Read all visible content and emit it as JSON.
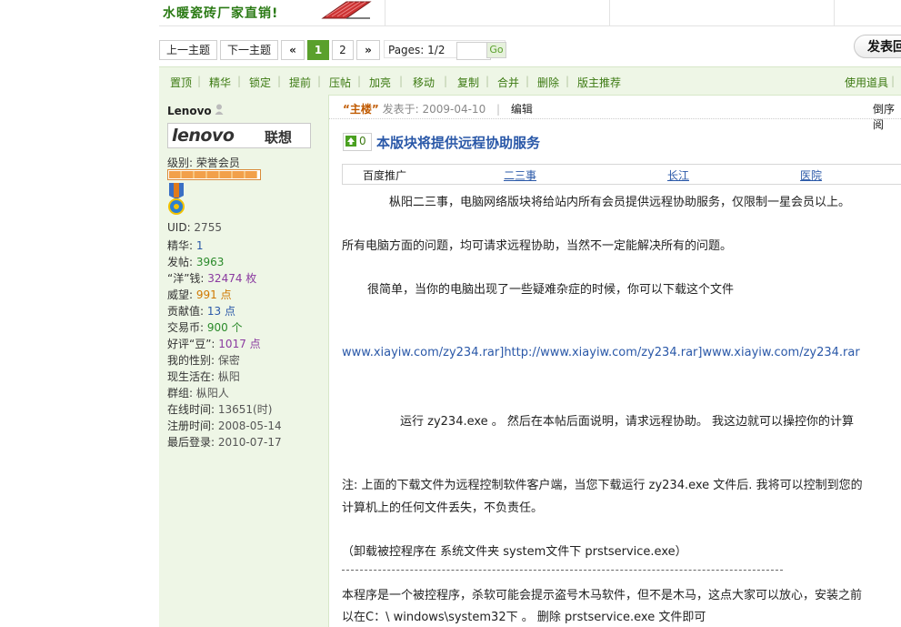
{
  "ad": {
    "text": "水暖瓷砖厂家直销!"
  },
  "pager": {
    "prev_topic": "上一主题",
    "next_topic": "下一主题",
    "first": "«",
    "page1": "1",
    "page2": "2",
    "next": "»",
    "pages_text": "Pages: 1/2",
    "go": "Go",
    "input_value": ""
  },
  "new_topic_button": "发表回",
  "toolbar": {
    "items": [
      "置顶",
      "精华",
      "锁定",
      "提前",
      "压帖",
      "加亮",
      "移动",
      "复制",
      "合并",
      "删除",
      "版主推荐"
    ],
    "right": "使用道具"
  },
  "user": {
    "name": "Lenovo",
    "logo_latin": "lenovo",
    "logo_cn": "联想",
    "level": "级别: 荣誉会员",
    "level_progress": 0.98,
    "fields": [
      {
        "label": "UID: ",
        "value": "2755",
        "cls": "val-gray"
      },
      {
        "label": "精华: ",
        "value": "1",
        "cls": "val-blue"
      },
      {
        "label": "发帖: ",
        "value": "3963",
        "cls": "val-green"
      },
      {
        "label": "“洋”钱: ",
        "value": "32474 枚",
        "cls": "val-purple"
      },
      {
        "label": "威望: ",
        "value": "991 点",
        "cls": "val-orange"
      },
      {
        "label": "贡献值: ",
        "value": "13 点",
        "cls": "val-blue"
      },
      {
        "label": "交易币: ",
        "value": "900 个",
        "cls": "val-green"
      },
      {
        "label": "好评“豆”: ",
        "value": "1017 点",
        "cls": "val-purple"
      },
      {
        "label": "我的性别: ",
        "value": "保密",
        "cls": "val-gray"
      },
      {
        "label": "现生活在: ",
        "value": "枞阳",
        "cls": "val-gray"
      },
      {
        "label": "群组: ",
        "value": "枞阳人",
        "cls": "val-gray"
      },
      {
        "label": "在线时间: ",
        "value": "13651(时)",
        "cls": "val-gray"
      },
      {
        "label": "注册时间: ",
        "value": "2008-05-14",
        "cls": "val-gray"
      },
      {
        "label": "最后登录: ",
        "value": "2010-07-17",
        "cls": "val-gray"
      }
    ]
  },
  "post": {
    "author_tag": "“主楼”",
    "posted_at": "发表于: 2009-04-10",
    "edit": "编辑",
    "reverse": "倒序阅",
    "vote_count": "0",
    "title": "本版块将提供远程协助服务",
    "links": [
      "百度推广",
      "二三事",
      "长江",
      "医院"
    ],
    "paragraphs": [
      "枞阳二三事，电脑网络版块将给站内所有会员提供远程协助服务，仅限制一星会员以上。",
      "所有电脑方面的问题，均可请求远程协助，当然不一定能解决所有的问题。",
      "很简单，当你的电脑出现了一些疑难杂症的时候，你可以下载这个文件",
      "www.xiayiw.com/zy234.rar]http://www.xiayiw.com/zy234.rar]www.xiayiw.com/zy234.rar",
      "运行  zy234.exe  。 然后在本帖后面说明，请求远程协助。   我这边就可以操控你的计算",
      "注:  上面的下载文件为远程控制软件客户端，当您下载运行 zy234.exe 文件后. 我将可以控制到您的",
      "计算机上的任何文件丢失，不负责任。",
      "（卸载被控程序在  系统文件夹 system文件下  prstservice.exe）",
      "本程序是一个被控程序，杀软可能会提示盗号木马软件，但不是木马，这点大家可以放心，安装之前",
      "以在C：\\ windows\\system32下  。  删除 prstservice.exe 文件即可"
    ]
  },
  "colors": {
    "green_accent": "#5aa02c",
    "toolbar_bg": "#eef6e6",
    "link_blue": "#2a58a8"
  }
}
